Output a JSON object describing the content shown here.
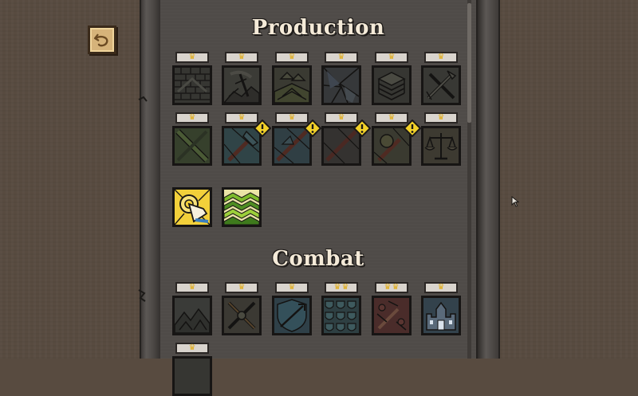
{
  "sections": {
    "production": {
      "title": "Production"
    },
    "combat": {
      "title": "Combat"
    }
  },
  "back_button": {
    "icon": "undo-arrow-icon"
  },
  "colors": {
    "background": "#584b40",
    "panel": "#4f4b48",
    "crown": "#e0ac1a",
    "warning": "#f2d129",
    "unlocked_gold": "#f2d03a",
    "unlocked_green": "#7dbb2c"
  },
  "production_tiles": [
    {
      "id": "p1",
      "crowns": 1,
      "icon": "brick-wall-icon"
    },
    {
      "id": "p2",
      "crowns": 1,
      "icon": "pickaxe-rock-icon"
    },
    {
      "id": "p3",
      "crowns": 1,
      "icon": "farm-field-icon"
    },
    {
      "id": "p4",
      "crowns": 1,
      "icon": "shards-icon"
    },
    {
      "id": "p5",
      "crowns": 1,
      "icon": "stacked-planks-icon"
    },
    {
      "id": "p6",
      "crowns": 1,
      "icon": "tools-crossed-icon"
    },
    {
      "id": "p7",
      "crowns": 1,
      "icon": "crossed-staves-icon"
    },
    {
      "id": "p8",
      "crowns": 1,
      "icon": "axe-icon",
      "warning": true
    },
    {
      "id": "p9",
      "crowns": 1,
      "icon": "spear-icon",
      "warning": true
    },
    {
      "id": "p10",
      "crowns": 1,
      "icon": "sword-icon",
      "warning": true
    },
    {
      "id": "p11",
      "crowns": 1,
      "icon": "torch-icon",
      "warning": true
    },
    {
      "id": "p12",
      "crowns": 1,
      "icon": "balance-scale-icon"
    }
  ],
  "unlocked_tiles": [
    {
      "id": "u1",
      "icon": "tap-hand-icon"
    },
    {
      "id": "u2",
      "icon": "green-chevrons-icon"
    }
  ],
  "combat_tiles": [
    {
      "id": "c1",
      "crowns": 1,
      "icon": "mountain-camp-icon"
    },
    {
      "id": "c2",
      "crowns": 1,
      "icon": "crossed-swords-icon"
    },
    {
      "id": "c3",
      "crowns": 1,
      "icon": "shield-arrow-icon"
    },
    {
      "id": "c4",
      "crowns": 2,
      "icon": "shield-rows-icon"
    },
    {
      "id": "c5",
      "crowns": 2,
      "icon": "broken-sword-icon"
    },
    {
      "id": "c6",
      "crowns": 1,
      "icon": "castle-icon"
    },
    {
      "id": "c7",
      "crowns": 1,
      "icon": "locked-icon"
    }
  ]
}
